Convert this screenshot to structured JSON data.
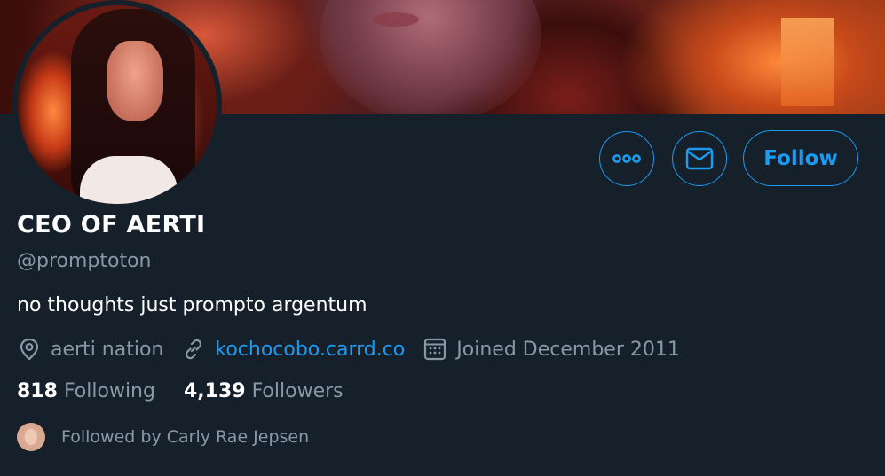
{
  "profile": {
    "display_name": "CEO OF AERTI",
    "handle": "@promptoton",
    "bio": "no thoughts just prompto argentum",
    "location": "aerti nation",
    "website": "kochocobo.carrd.co",
    "joined": "Joined December 2011"
  },
  "actions": {
    "follow_label": "Follow"
  },
  "stats": {
    "following_count": "818",
    "following_label": "Following",
    "followers_count": "4,139",
    "followers_label": "Followers"
  },
  "followed_by": {
    "text": "Followed by Carly Rae Jepsen"
  },
  "icons": {
    "more": "more-icon",
    "mail": "mail-icon",
    "location": "location-pin-icon",
    "link": "link-icon",
    "calendar": "calendar-icon"
  },
  "colors": {
    "background": "#15202b",
    "accent": "#1d9bf0",
    "secondary_text": "#8899a6",
    "primary_text": "#ffffff"
  }
}
